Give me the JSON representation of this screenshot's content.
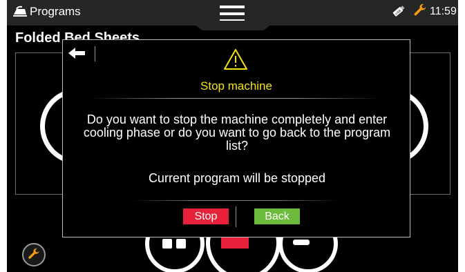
{
  "header": {
    "title": "Programs",
    "clock": "11:59",
    "icons": {
      "app": "iron-icon",
      "menu": "hamburger-menu-icon",
      "usb": "usb-stick-icon",
      "service": "wrench-icon"
    },
    "colors": {
      "accent": "#f39c12"
    }
  },
  "program": {
    "title": "Folded Bed Sheets"
  },
  "dialog": {
    "title": "Stop machine",
    "message": "Do you want to stop the machine completely and enter cooling phase or do you want to go back to the program list?",
    "note": "Current program will be stopped",
    "stop_label": "Stop",
    "back_label": "Back",
    "colors": {
      "title": "#f5e21b",
      "stop": "#e8213a",
      "back": "#6dbb3c"
    }
  }
}
